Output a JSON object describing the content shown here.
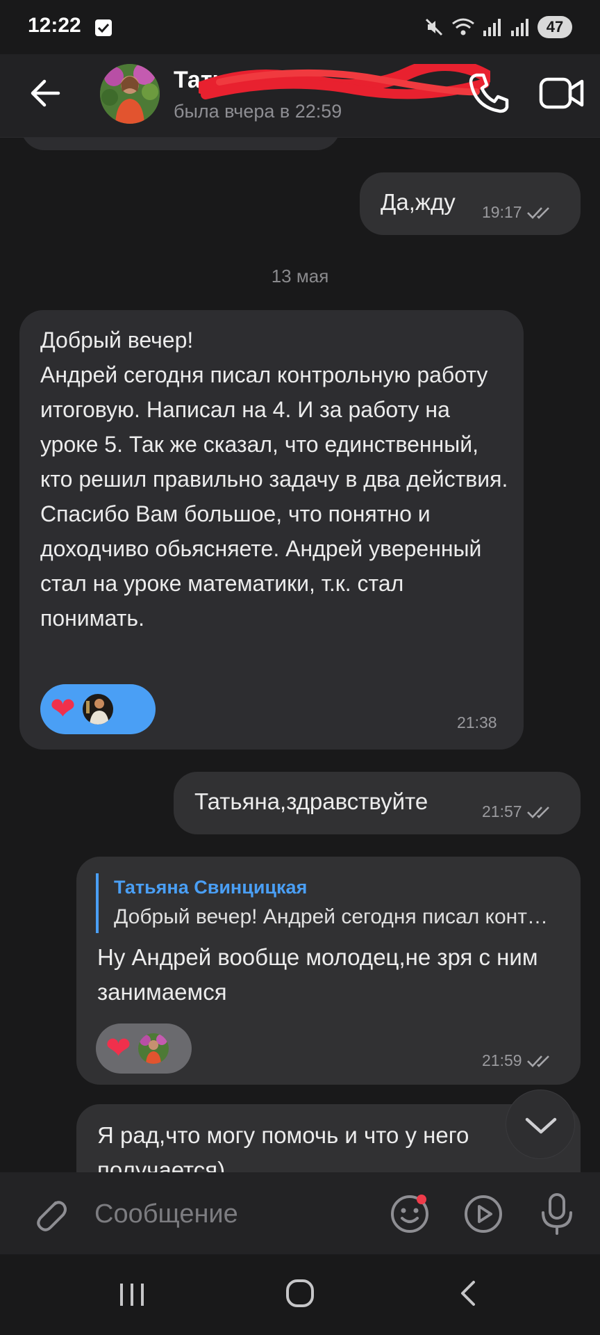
{
  "status_bar": {
    "time": "12:22",
    "battery": "47"
  },
  "header": {
    "contact_name": "Татьяна",
    "last_seen": "была вчера в 22:59",
    "icons": {
      "back": "arrow-left-icon",
      "call": "phone-icon",
      "video": "video-camera-icon"
    }
  },
  "chat": {
    "messages": [
      {
        "direction": "out",
        "text": "Да,жду",
        "time": "19:17",
        "read": true
      },
      {
        "type": "date",
        "text": "13 мая"
      },
      {
        "direction": "in",
        "text": "Добрый вечер!\nАндрей сегодня писал контрольную работу итоговую. Написал на 4. И за работу на уроке 5. Так же сказал, что единственный, кто решил правильно задачу в два действия. Спасибо Вам большое, что понятно и доходчиво обьясняете. Андрей уверенный стал на уроке математики, т.к. стал понимать.",
        "time": "21:38",
        "reaction": "heart"
      },
      {
        "direction": "out",
        "text": "Татьяна,здравствуйте",
        "time": "21:57",
        "read": true
      },
      {
        "direction": "out",
        "reply_to": {
          "author": "Татьяна Свинцицкая",
          "snippet": "Добрый вечер! Андрей сегодня писал контрольную работу"
        },
        "text": "Ну Андрей вообще молодец,не зря с ним занимаемся",
        "time": "21:59",
        "read": true,
        "reaction": "heart"
      },
      {
        "direction": "out",
        "text": "Я рад,что могу помочь и что у него получается)"
      }
    ]
  },
  "composer": {
    "placeholder": "Сообщение",
    "icons": [
      "paperclip-icon",
      "emoji-icon",
      "video-message-icon",
      "microphone-icon"
    ]
  },
  "colors": {
    "background": "#19191a",
    "bubble": "#2d2d30",
    "accent": "#4a9ff5",
    "reaction_bg": "#4a9ff5",
    "heart": "#f0304c"
  }
}
